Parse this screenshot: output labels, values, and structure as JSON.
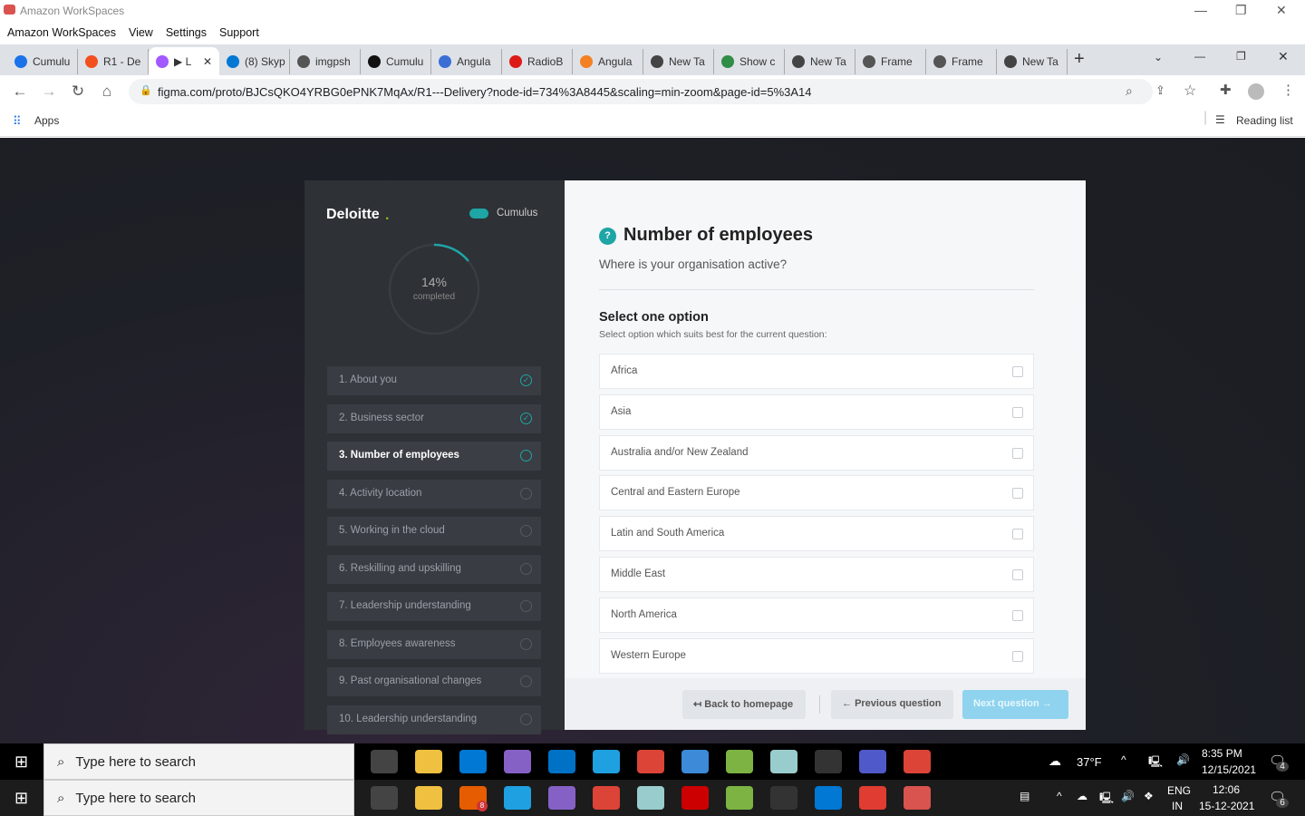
{
  "window": {
    "title": "Amazon WorkSpaces",
    "menu": [
      "Amazon WorkSpaces",
      "View",
      "Settings",
      "Support"
    ]
  },
  "browser": {
    "tabs": [
      {
        "label": "Cumulu",
        "color": "#1a73e8"
      },
      {
        "label": "R1 - De",
        "color": "#f24e1e"
      },
      {
        "label": "▶ L",
        "color": "#a259ff",
        "active": true
      },
      {
        "label": "(8) Skyp",
        "color": "#0078d4"
      },
      {
        "label": "imgpsh",
        "color": "#555"
      },
      {
        "label": "Cumulu",
        "color": "#111"
      },
      {
        "label": "Angula",
        "color": "#3b6fd6"
      },
      {
        "label": "RadioB",
        "color": "#dd1b16"
      },
      {
        "label": "Angula",
        "color": "#f48024"
      },
      {
        "label": "New Ta",
        "color": "#444"
      },
      {
        "label": "Show c",
        "color": "#2f8d46"
      },
      {
        "label": "New Ta",
        "color": "#444"
      },
      {
        "label": "Frame",
        "color": "#555"
      },
      {
        "label": "Frame",
        "color": "#555"
      },
      {
        "label": "New Ta",
        "color": "#444"
      }
    ],
    "url": "figma.com/proto/BJCsQKO4YRBG0ePNK7MqAx/R1---Delivery?node-id=734%3A8445&scaling=min-zoom&page-id=5%3A14",
    "bookmarks_apps": "Apps",
    "reading_list": "Reading list"
  },
  "sidebar": {
    "brand": "Deloitte",
    "product": "Cumulus",
    "progress_percent": 14,
    "progress_label": "14%",
    "progress_sub": "completed",
    "steps": [
      {
        "label": "1. About you",
        "state": "done"
      },
      {
        "label": "2. Business sector",
        "state": "done"
      },
      {
        "label": "3. Number of employees",
        "state": "current"
      },
      {
        "label": "4. Activity location",
        "state": "todo"
      },
      {
        "label": "5. Working in the cloud",
        "state": "todo"
      },
      {
        "label": "6. Reskilling and upskilling",
        "state": "todo"
      },
      {
        "label": "7. Leadership understanding",
        "state": "todo"
      },
      {
        "label": "8. Employees awareness",
        "state": "todo"
      },
      {
        "label": "9. Past organisational changes",
        "state": "todo"
      },
      {
        "label": "10. Leadership understanding",
        "state": "todo"
      }
    ]
  },
  "question": {
    "title": "Number of employees",
    "subtitle": "Where is your organisation active?",
    "select_heading": "Select one option",
    "select_hint": "Select option which suits best for the current question:",
    "options": [
      "Africa",
      "Asia",
      "Australia and/or New Zealand",
      "Central and Eastern Europe",
      "Latin and South America",
      "Middle East",
      "North America",
      "Western Europe"
    ]
  },
  "footer": {
    "back": "Back to homepage",
    "previous": "Previous question",
    "next": "Next question"
  },
  "taskbar1": {
    "search": "Type here to search",
    "weather": "37°F",
    "time": "8:35 PM",
    "date": "12/15/2021",
    "notifications": "4"
  },
  "taskbar2": {
    "search": "Type here to search",
    "lang": "ENG",
    "region": "IN",
    "time": "12:06",
    "date": "15-12-2021",
    "notifications": "6",
    "skype_badge": "8"
  },
  "colors": {
    "accent": "#1ea5a5",
    "next_button": "#8fd3ef"
  }
}
